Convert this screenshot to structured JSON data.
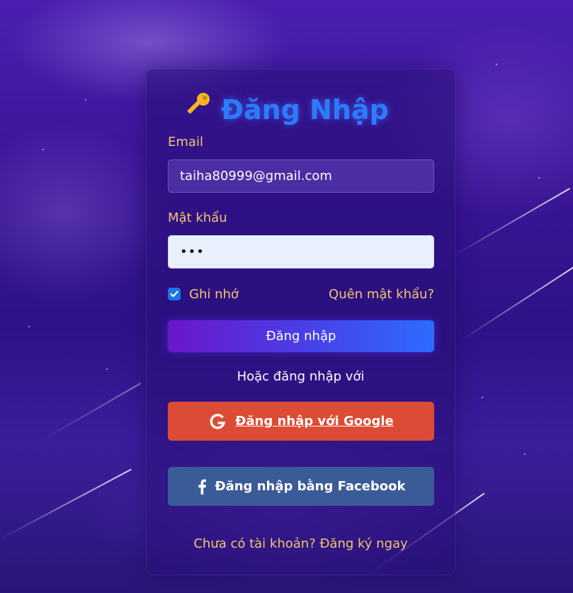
{
  "login": {
    "title": "Đăng Nhập",
    "title_icon": "key-icon",
    "email_label": "Email",
    "email_value": "taiha80999@gmail.com",
    "password_label": "Mật khẩu",
    "password_value": "•••",
    "remember_label": "Ghi nhớ",
    "remember_checked": true,
    "forgot_link": "Quên mật khẩu?",
    "submit_label": "Đăng nhập",
    "or_text": "Hoặc đăng nhập với",
    "google_label": "Đăng nhập với Google",
    "facebook_label": "Đăng nhập bằng Facebook",
    "register_text": "Chưa có tài khoản? Đăng ký ngay"
  },
  "colors": {
    "title": "#2d7bff",
    "label": "#f2c66b",
    "google": "#dc4b35",
    "facebook": "#3b5b98",
    "checkbox": "#1a73e8"
  }
}
